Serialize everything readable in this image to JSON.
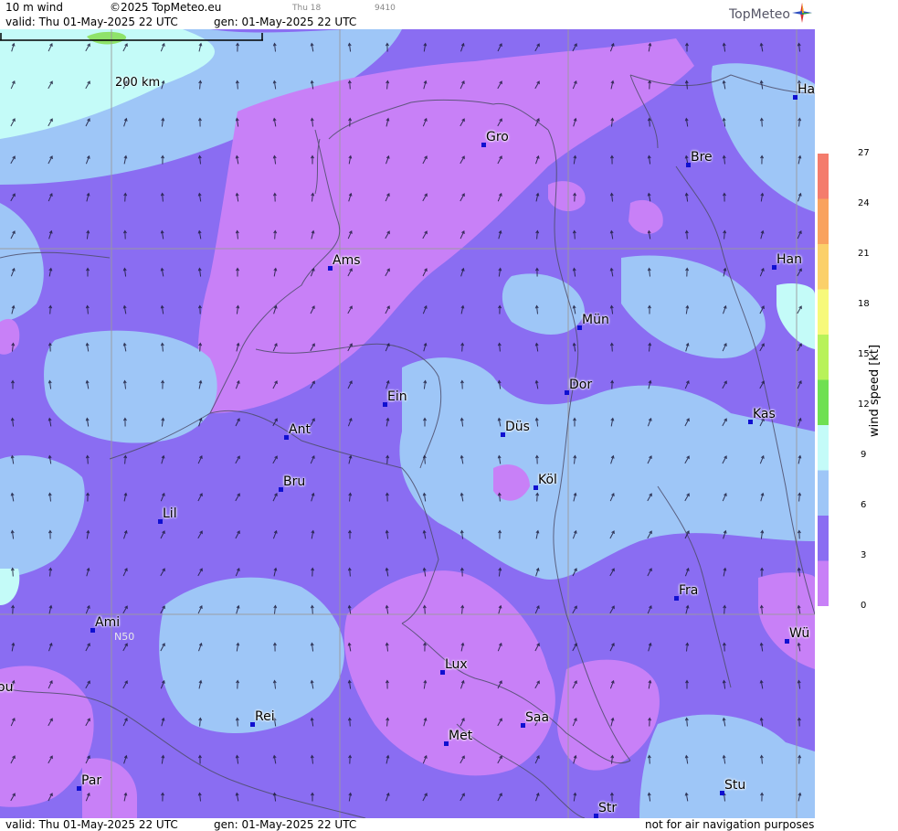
{
  "header": {
    "field": "10 m wind",
    "copyright": "©2025 TopMeteo.eu",
    "day": "Thu 18",
    "code": "9410",
    "valid": "valid:  Thu  01-May-2025  22 UTC",
    "gen": "gen: 01-May-2025 22 UTC",
    "logo": "TopMeteo"
  },
  "footer": {
    "valid": "valid:  Thu  01-May-2025  22 UTC",
    "gen": "gen: 01-May-2025 22 UTC",
    "disclaimer": "not for air navigation purposes"
  },
  "map": {
    "scale_label": "200 km",
    "lat_label": "N50",
    "cities": [
      "Ha",
      "Gro",
      "Bre",
      "Ams",
      "Han",
      "Mün",
      "Ein",
      "Dor",
      "Ant",
      "Düs",
      "Kas",
      "Köl",
      "Bru",
      "Lil",
      "Fra",
      "Ami",
      "Wü",
      "Lux",
      "ou",
      "Rei",
      "Saa",
      "Met",
      "Par",
      "Stu",
      "Str"
    ]
  },
  "legend": {
    "unit": "wind  speed  [kt]",
    "ticks": [
      "27",
      "24",
      "21",
      "18",
      "15",
      "12",
      "9",
      "6",
      "3",
      "0"
    ],
    "colors": [
      "#f47c6c",
      "#f9a25e",
      "#fbd06a",
      "#f7f97a",
      "#b8f25a",
      "#6fe052",
      "#c4fbf8",
      "#9ec6f7",
      "#8a6df2",
      "#c880f7"
    ]
  }
}
